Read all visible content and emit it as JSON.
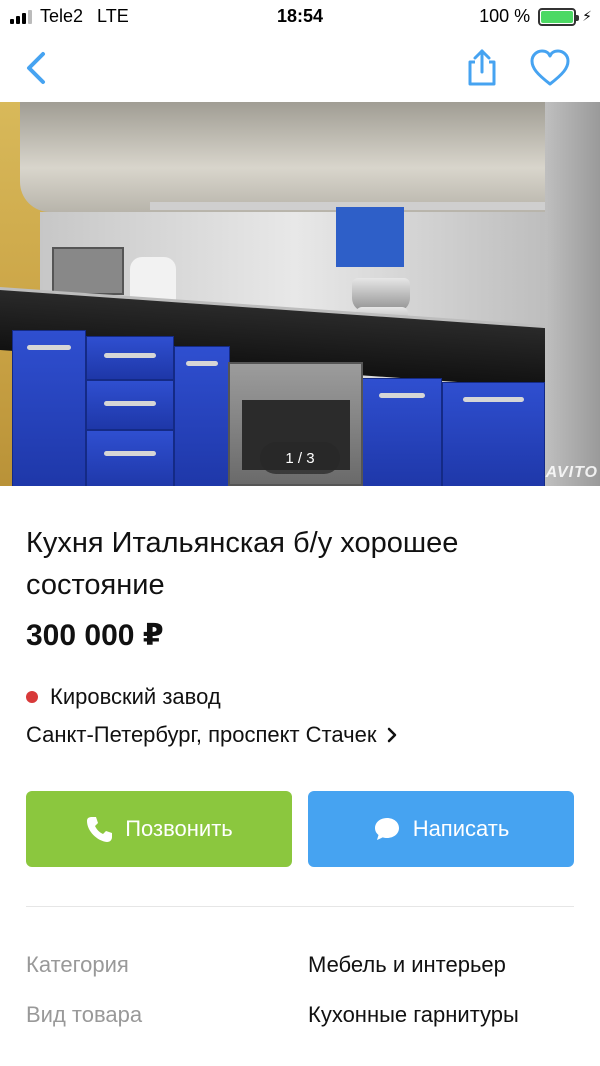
{
  "status_bar": {
    "carrier": "Tele2",
    "network": "LTE",
    "time": "18:54",
    "battery": "100 %",
    "battery_level": 1.0
  },
  "nav": {
    "back_icon": "chevron-left-icon",
    "share_icon": "share-icon",
    "favorite_icon": "heart-icon"
  },
  "gallery": {
    "counter": "1 / 3",
    "current": 1,
    "total": 3,
    "watermark": "AVITO"
  },
  "listing": {
    "title": "Кухня Итальянская б/у хорошее состояние",
    "price": "300 000 ₽",
    "metro_station": "Кировский завод",
    "metro_color": "#d83a3a",
    "address": "Санкт-Петербург, проспект Стачек"
  },
  "actions": {
    "call_label": "Позвонить",
    "call_color": "#8bc73e",
    "write_label": "Написать",
    "write_color": "#46a3f1"
  },
  "params": [
    {
      "label": "Категория",
      "value": "Мебель и интерьер"
    },
    {
      "label": "Вид товара",
      "value": "Кухонные гарнитуры"
    }
  ],
  "colors": {
    "accent": "#46a3f1",
    "muted_text": "#999999"
  }
}
